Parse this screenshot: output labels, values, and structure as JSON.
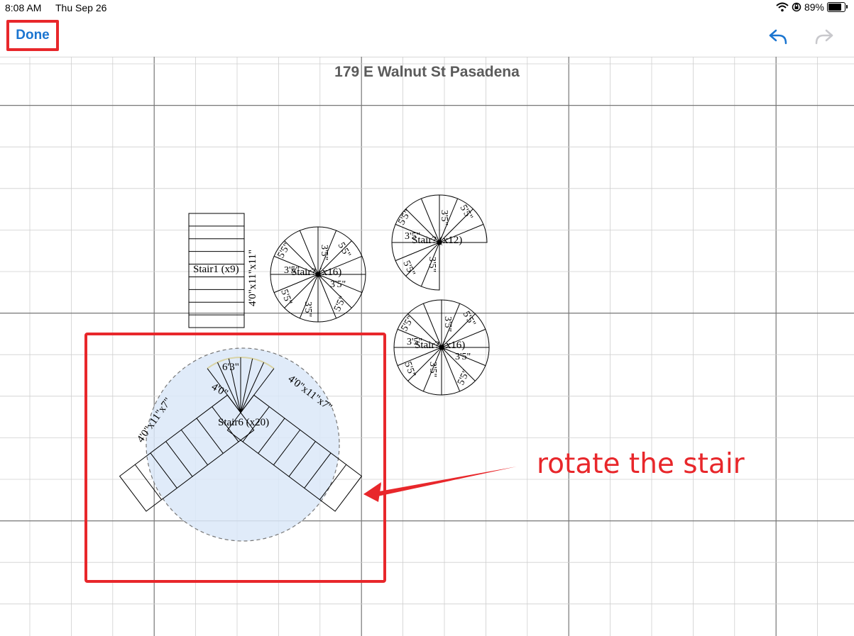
{
  "status_bar": {
    "time": "8:08 AM",
    "date": "Thu Sep 26",
    "battery": "89%",
    "icons": [
      "wifi-icon",
      "orientation-lock-icon",
      "battery-icon"
    ]
  },
  "nav": {
    "done_label": "Done",
    "undo_icon": "undo-arrow-icon",
    "redo_icon": "redo-arrow-icon",
    "accent": "#1b75d0"
  },
  "plan": {
    "title": "179 E Walnut St Pasadena",
    "stairs": [
      {
        "label": "Stair1 (x9)",
        "size": "4'0\"x11\"x11\""
      },
      {
        "label": "Stair? (x16)",
        "diameter": "3'5\"",
        "radius": "5'5\""
      },
      {
        "label": "Stair? (x12)",
        "diameter": "3'5\"",
        "radius": "5'5\""
      },
      {
        "label": "Stair? (x16)",
        "diameter": "3'5\"",
        "radius": "5'5\""
      },
      {
        "label": "Stair6 (x20)",
        "run_left": "4'0\"x11\"x7\"",
        "run_right": "4'0\"x11\"x7\"",
        "landing_width": "6'3\"",
        "landing_depth": "4'0\""
      }
    ]
  },
  "annotation": {
    "text": "rotate the stair",
    "color": "#e8272b"
  }
}
